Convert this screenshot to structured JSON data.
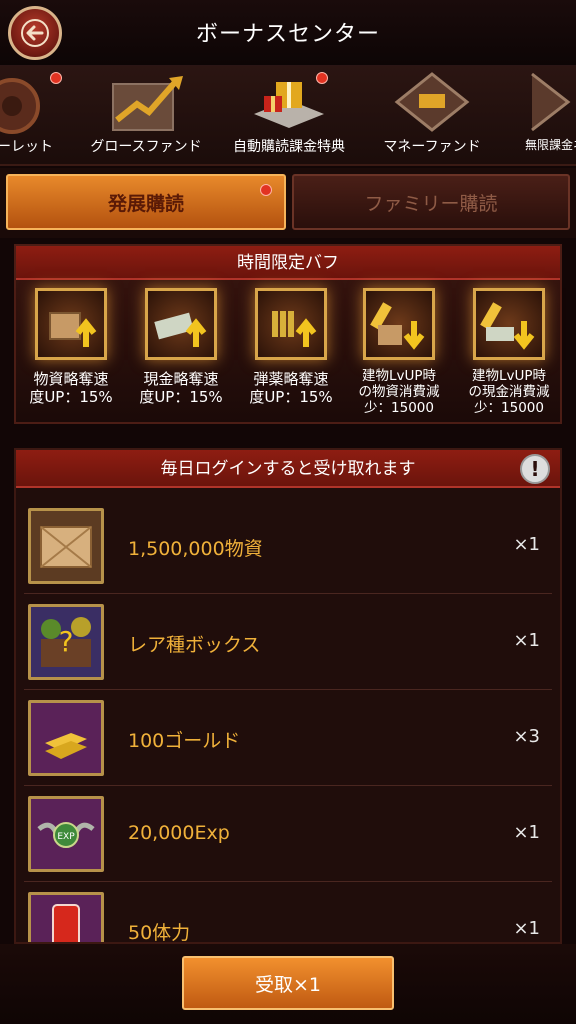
{
  "header": {
    "title": "ボーナスセンター"
  },
  "carousel": {
    "items": [
      {
        "label": "ーレット",
        "dot": true
      },
      {
        "label": "グロースファンド",
        "dot": false
      },
      {
        "label": "自動購読課金特典",
        "dot": true
      },
      {
        "label": "マネーファンド",
        "dot": false
      },
      {
        "label": "無限課金ネ",
        "dot": false
      }
    ]
  },
  "tabs": {
    "active": "発展購読",
    "inactive": "ファミリー購読"
  },
  "buff_panel": {
    "title": "時間限定バフ",
    "buffs": [
      {
        "name": "物資略奪速\n度UP：15%"
      },
      {
        "name": "現金略奪速\n度UP：15%"
      },
      {
        "name": "弾薬略奪速\n度UP：15%"
      },
      {
        "name": "建物LvUP時\nの物資消費減\n少：15000"
      },
      {
        "name": "建物LvUP時\nの現金消費減\n少：15000"
      }
    ]
  },
  "daily_panel": {
    "title": "毎日ログインすると受け取れます",
    "info_symbol": "!",
    "rewards": [
      {
        "name": "1,500,000物資",
        "qty": "×1",
        "icon": "crate-icon"
      },
      {
        "name": "レア種ボックス",
        "qty": "×1",
        "icon": "mystery-box-icon"
      },
      {
        "name": "100ゴールド",
        "qty": "×3",
        "icon": "gold-bars-icon"
      },
      {
        "name": "20,000Exp",
        "qty": "×1",
        "icon": "exp-badge-icon"
      },
      {
        "name": "50体力",
        "qty": "×1",
        "icon": "energy-can-icon"
      }
    ]
  },
  "claim_button": {
    "label": "受取×1"
  },
  "colors": {
    "accent": "#e8892b",
    "banner": "#8e1d12",
    "reward_text": "#f0b13a"
  }
}
